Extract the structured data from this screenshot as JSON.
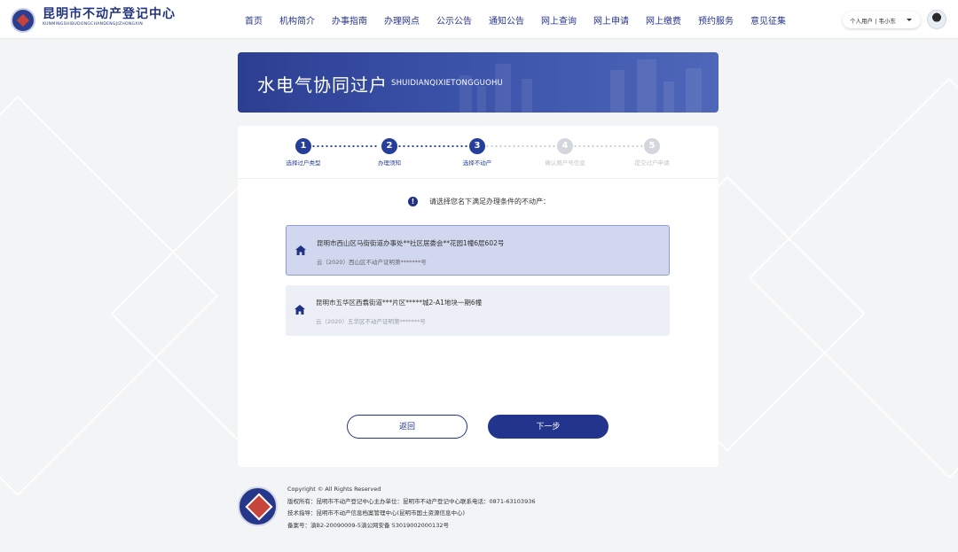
{
  "header": {
    "brand_cn": "昆明市不动产登记中心",
    "brand_en": "KUNMINGSHIBUDONGCHANDENGJIZHONGXIN",
    "nav": [
      "首页",
      "机构简介",
      "办事指南",
      "办理网点",
      "公示公告",
      "通知公告",
      "网上查询",
      "网上申请",
      "网上缴费",
      "预约服务",
      "意见征集"
    ],
    "user_label": "个人用户 | 韦小东"
  },
  "banner": {
    "title": "水电气协同过户",
    "subtitle": "SHUIDIANQIXIETONGGUOHU"
  },
  "steps": [
    {
      "num": "1",
      "label": "选择过户类型",
      "state": "active"
    },
    {
      "num": "2",
      "label": "办理须知",
      "state": "active"
    },
    {
      "num": "3",
      "label": "选择不动产",
      "state": "active"
    },
    {
      "num": "4",
      "label": "确认原户号信息",
      "state": "inactive"
    },
    {
      "num": "5",
      "label": "提交过户申请",
      "state": "inactive"
    }
  ],
  "notice": "请选择您名下满足办理条件的不动产：",
  "properties": [
    {
      "address": "昆明市西山区马街街道办事处**社区居委会**花园1幢6层602号",
      "cert": "云（2020）西山区不动产证明第*******号",
      "selected": true
    },
    {
      "address": "昆明市五华区西翥街道***片区*****城2-A1地块一期6幢",
      "cert": "云（2020）五华区不动产证明第*******号",
      "selected": false
    }
  ],
  "buttons": {
    "back": "返回",
    "next": "下一步"
  },
  "footer": {
    "copyright": "Copyright © All Rights Reserved",
    "owner": "版权所有：昆明市不动产登记中心主办单位：昆明市不动产登记中心联系电话：0871-63103936",
    "tech": "技术指导：昆明市不动产信息档案管理中心(昆明市国土资源信息中心)",
    "icp": "备案号：滇B2-20090009-5滇公网安备 53019002000132号"
  },
  "colors": {
    "primary": "#253e9a",
    "selected_bg": "#d1d7ef",
    "card_bg": "#ffffff",
    "page_bg": "#f3f4f6"
  }
}
